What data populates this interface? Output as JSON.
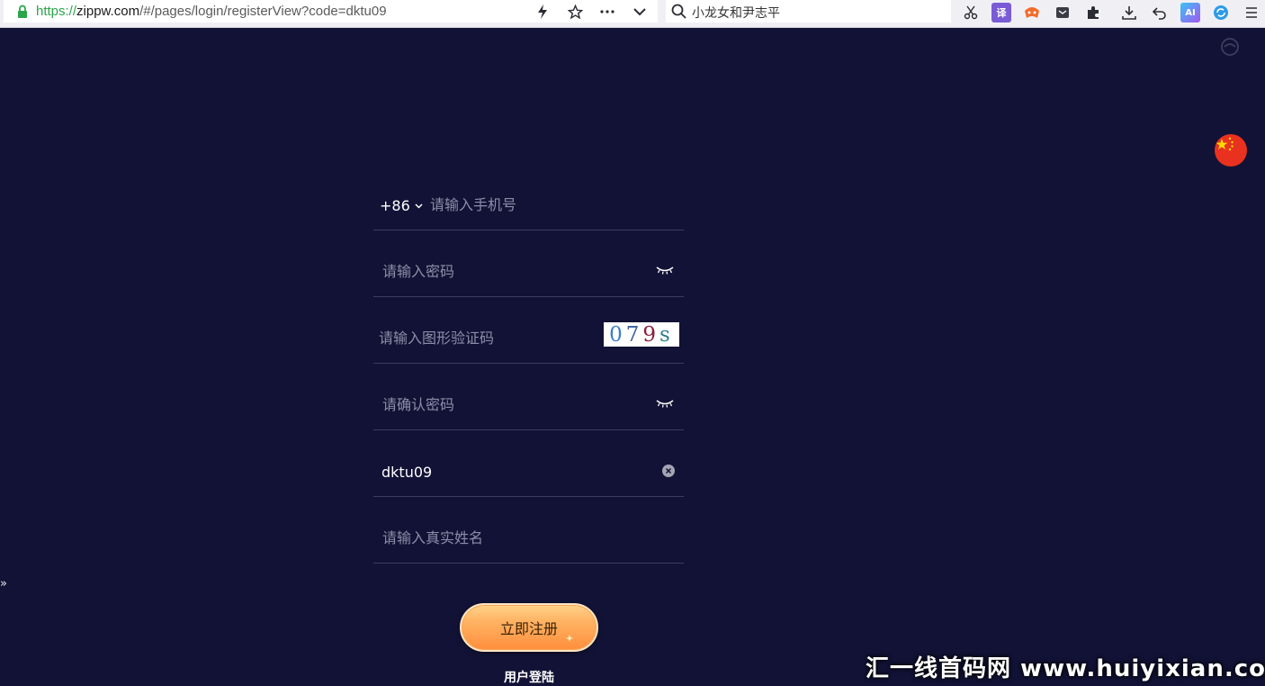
{
  "browser": {
    "url_protocol": "https://",
    "url_host": "zippw.com",
    "url_path": "/#/pages/login/registerView?code=dktu09",
    "search_text": "小龙女和尹志平",
    "toolbar_translate_label": "译",
    "toolbar_ai_label": "AI"
  },
  "form": {
    "country_code": "+86",
    "phone_placeholder": "请输入手机号",
    "password_placeholder": "请输入密码",
    "captcha_placeholder": "请输入图形验证码",
    "captcha_code": [
      "0",
      "7",
      "9",
      "s"
    ],
    "confirm_password_placeholder": "请确认密码",
    "invite_code_value": "dktu09",
    "real_name_placeholder": "请输入真实姓名",
    "register_button": "立即注册",
    "login_link": "用户登陆"
  },
  "watermark": "汇一线首码网 www.huiyixian.com",
  "colors": {
    "page_bg": "#121236",
    "divider": "#3b3b5c",
    "placeholder": "#8d8da8",
    "button_gradient_top": "#ffd38a",
    "button_gradient_bottom": "#ff8e3c"
  }
}
